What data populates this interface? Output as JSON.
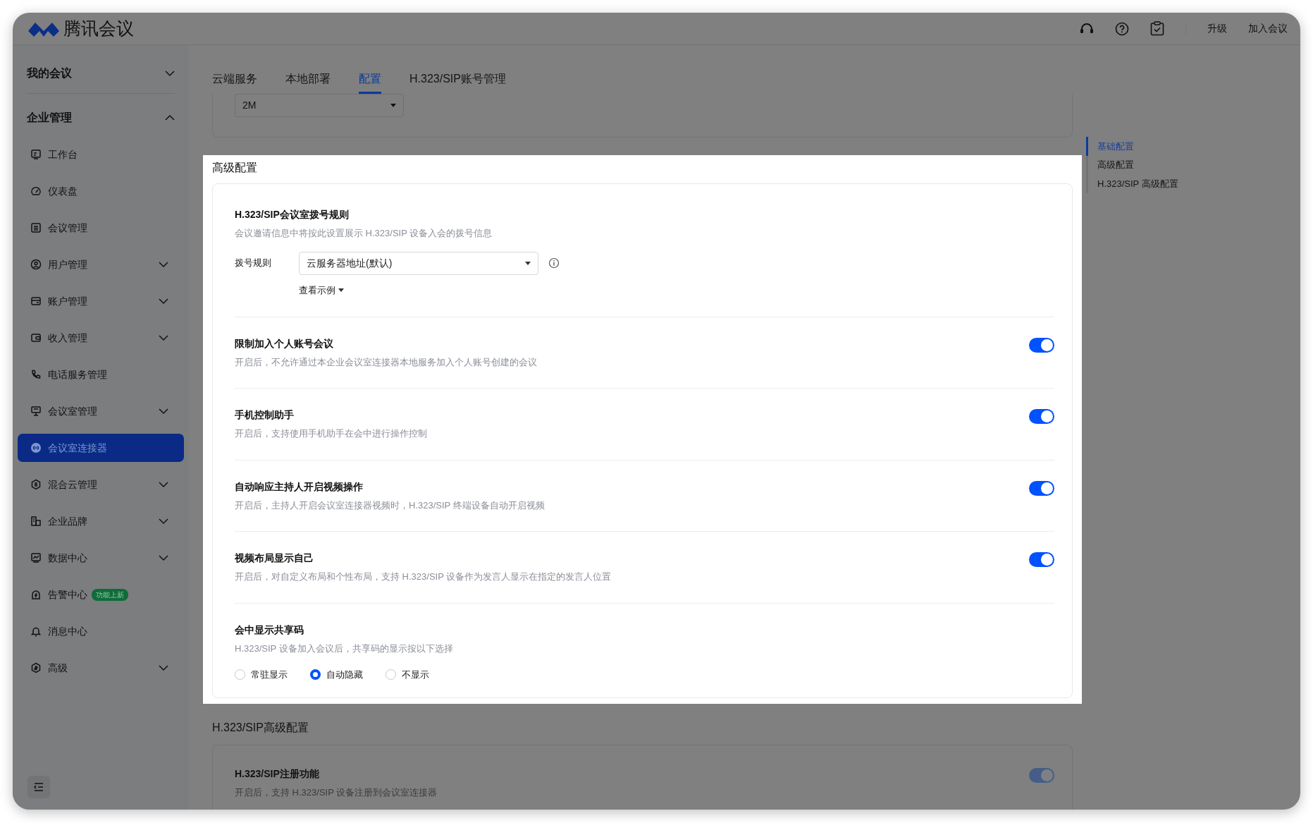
{
  "header": {
    "logo_text": "腾讯会议",
    "actions": [
      {
        "label": "升级"
      },
      {
        "label": "加入会议"
      }
    ]
  },
  "sidebar": {
    "groups": [
      {
        "label": "我的会议",
        "expanded": false
      },
      {
        "label": "企业管理",
        "expanded": true
      }
    ],
    "items": [
      {
        "label": "工作台",
        "expandable": false,
        "selected": false
      },
      {
        "label": "仪表盘",
        "expandable": false,
        "selected": false
      },
      {
        "label": "会议管理",
        "expandable": false,
        "selected": false
      },
      {
        "label": "用户管理",
        "expandable": true,
        "selected": false
      },
      {
        "label": "账户管理",
        "expandable": true,
        "selected": false
      },
      {
        "label": "收入管理",
        "expandable": true,
        "selected": false
      },
      {
        "label": "电话服务管理",
        "expandable": false,
        "selected": false
      },
      {
        "label": "会议室管理",
        "expandable": true,
        "selected": false
      },
      {
        "label": "会议室连接器",
        "expandable": false,
        "selected": true
      },
      {
        "label": "混合云管理",
        "expandable": true,
        "selected": false
      },
      {
        "label": "企业品牌",
        "expandable": true,
        "selected": false
      },
      {
        "label": "数据中心",
        "expandable": true,
        "selected": false
      },
      {
        "label": "告警中心",
        "expandable": false,
        "selected": false,
        "badge": "功能上新"
      },
      {
        "label": "消息中心",
        "expandable": false,
        "selected": false
      },
      {
        "label": "高级",
        "expandable": true,
        "selected": false
      }
    ]
  },
  "tabs": [
    {
      "label": "云端服务",
      "selected": false
    },
    {
      "label": "本地部署",
      "selected": false
    },
    {
      "label": "配置",
      "selected": true
    },
    {
      "label": "H.323/SIP账号管理",
      "selected": false
    }
  ],
  "basic_section": {
    "bandwidth_value": "2M"
  },
  "advanced_section": {
    "title": "高级配置",
    "dial_rule": {
      "title": "H.323/SIP会议室拨号规则",
      "description": "会议邀请信息中将按此设置展示 H.323/SIP 设备入会的拨号信息",
      "label": "拨号规则",
      "value": "云服务器地址(默认)",
      "example_link": "查看示例"
    },
    "toggles": [
      {
        "title": "限制加入个人账号会议",
        "description": "开启后，不允许通过本企业会议室连接器本地服务加入个人账号创建的会议",
        "on": true
      },
      {
        "title": "手机控制助手",
        "description": "开启后，支持使用手机助手在会中进行操作控制",
        "on": true
      },
      {
        "title": "自动响应主持人开启视频操作",
        "description": "开启后，主持人开启会议室连接器视频时，H.323/SIP 终端设备自动开启视频",
        "on": true
      },
      {
        "title": "视频布局显示自己",
        "description": "开启后，对自定义布局和个性布局，支持 H.323/SIP 设备作为发言人显示在指定的发言人位置",
        "on": true
      }
    ],
    "share_code": {
      "title": "会中显示共享码",
      "description": "H.323/SIP 设备加入会议后，共享码的显示按以下选择",
      "options": [
        {
          "label": "常驻显示",
          "selected": false
        },
        {
          "label": "自动隐藏",
          "selected": true
        },
        {
          "label": "不显示",
          "selected": false
        }
      ]
    }
  },
  "sip_section": {
    "title": "H.323/SIP高级配置",
    "settings": [
      {
        "title": "H.323/SIP注册功能",
        "description": "开启后，支持 H.323/SIP 设备注册到会议室连接器",
        "on": true
      }
    ]
  },
  "anchor_nav": [
    {
      "label": "基础配置",
      "selected": true
    },
    {
      "label": "高级配置",
      "selected": false
    },
    {
      "label": "H.323/SIP 高级配置",
      "selected": false
    }
  ]
}
